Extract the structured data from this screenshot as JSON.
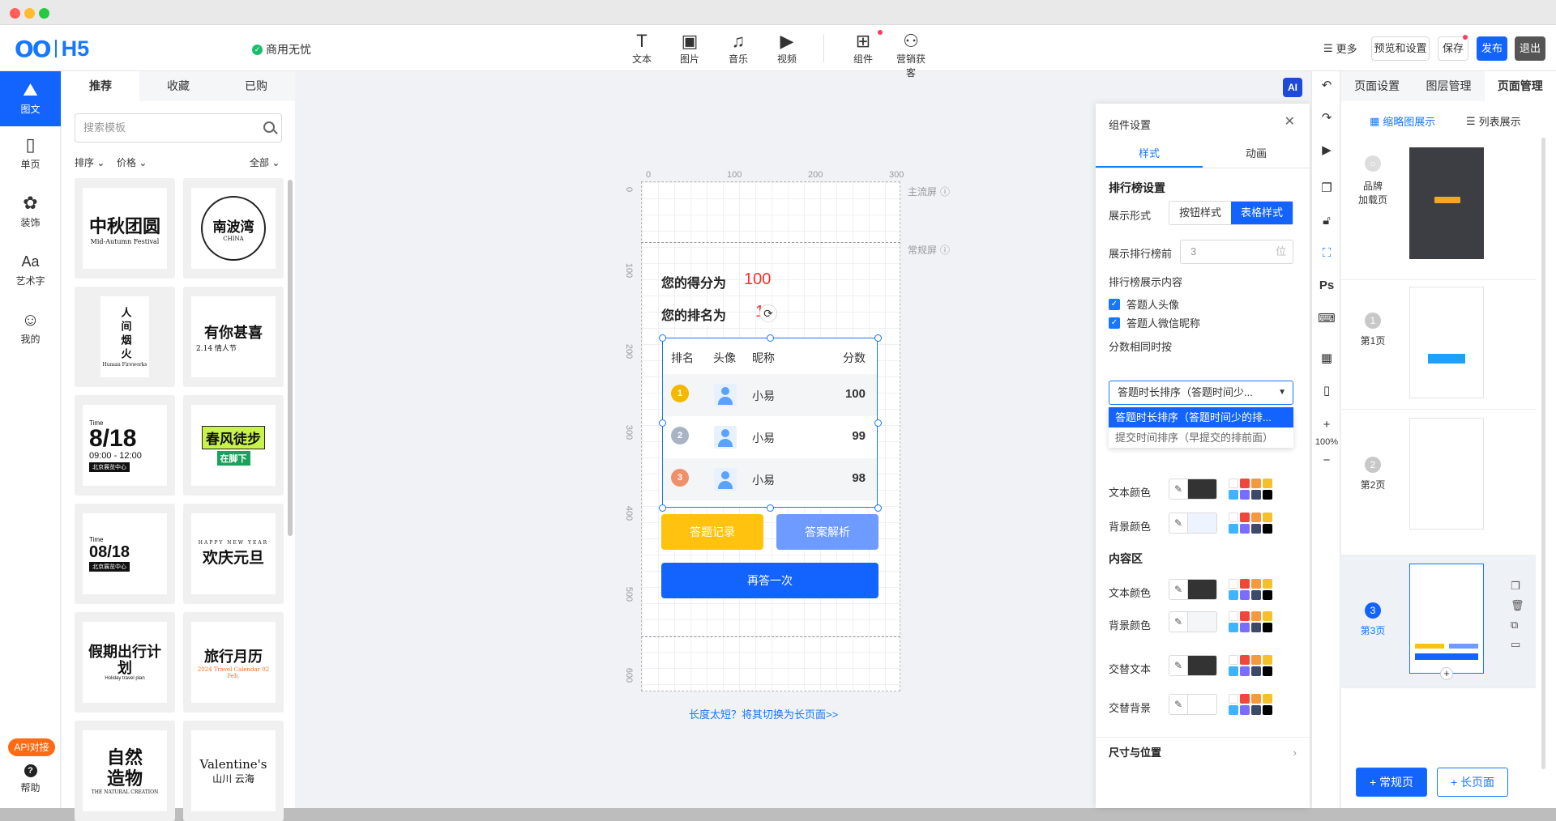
{
  "header": {
    "logo_mark": "OO",
    "logo_text": "H5",
    "status": "商用无忧",
    "tools": [
      {
        "label": "文本",
        "icon": "text-icon",
        "glyph": "T"
      },
      {
        "label": "图片",
        "icon": "image-icon",
        "glyph": "▣"
      },
      {
        "label": "音乐",
        "icon": "music-icon",
        "glyph": "♫"
      },
      {
        "label": "视频",
        "icon": "video-icon",
        "glyph": "▶"
      },
      {
        "label": "组件",
        "icon": "component-icon",
        "glyph": "⊞"
      },
      {
        "label": "营销获客",
        "icon": "users-icon",
        "glyph": "⚇"
      }
    ],
    "more": "更多",
    "preview": "预览和设置",
    "save": "保存",
    "publish": "发布",
    "exit": "退出"
  },
  "left_nav": {
    "items": [
      {
        "label": "图文",
        "icon": "image-text-icon",
        "glyph": "⛰"
      },
      {
        "label": "单页",
        "icon": "single-page-icon",
        "glyph": "▯"
      },
      {
        "label": "装饰",
        "icon": "palette-icon",
        "glyph": "✿"
      },
      {
        "label": "艺术字",
        "icon": "art-text-icon",
        "glyph": "Aa"
      },
      {
        "label": "我的",
        "icon": "user-icon",
        "glyph": "☺"
      }
    ],
    "api": "API对接",
    "help": "帮助",
    "help_glyph": "?"
  },
  "templates": {
    "tabs": [
      "推荐",
      "收藏",
      "已购"
    ],
    "search_placeholder": "搜索模板",
    "filters": {
      "sort": "排序",
      "price": "价格",
      "all": "全部"
    },
    "cards": [
      {
        "text": "中秋团圆",
        "sub": "Mid-Autumn Festival"
      },
      {
        "text": "南波湾",
        "sub": "CHINA"
      },
      {
        "text": "人间烟火",
        "sub": "Human Fireworks"
      },
      {
        "text": "有你甚喜",
        "sub": "2.14 情人节"
      },
      {
        "text": "8/18",
        "sub": "09:00 - 12:00",
        "note": "北京展览中心",
        "top": "Time"
      },
      {
        "text": "春风徒步",
        "sub": "在脚下"
      },
      {
        "text": "08/18",
        "sub": "北京展览中心",
        "top": "Time"
      },
      {
        "text": "欢庆元旦",
        "sub": "HAPPY NEW YEAR"
      },
      {
        "text": "假期出行计划",
        "sub": "Holiday travel plan"
      },
      {
        "text": "旅行月历",
        "sub": "2024 Travel Calendar 02 Feb."
      },
      {
        "text": "自然造物",
        "sub": "THE NATURAL CREATION"
      },
      {
        "text": "Valentine's",
        "sub": "山川 云海"
      }
    ]
  },
  "canvas": {
    "ruler_top": [
      "0",
      "100",
      "200",
      "300"
    ],
    "ruler_left": [
      "0",
      "100",
      "200",
      "300",
      "400",
      "500",
      "600"
    ],
    "main_screen": "主流屏",
    "normal_screen": "常规屏",
    "score_label": "您的得分为",
    "score_value": "100",
    "rank_label": "您的排名为",
    "rank_value": "1",
    "table": {
      "headers": [
        "排名",
        "头像",
        "昵称",
        "分数"
      ],
      "rows": [
        {
          "rank": "1",
          "name": "小易",
          "score": "100",
          "color": "#f5b800"
        },
        {
          "rank": "2",
          "name": "小易",
          "score": "99",
          "color": "#a8b4c4"
        },
        {
          "rank": "3",
          "name": "小易",
          "score": "98",
          "color": "#f0906a"
        }
      ]
    },
    "btn_record": "答题记录",
    "btn_analysis": "答案解析",
    "btn_retry": "再答一次",
    "switch_link": "长度太短？将其切换为长页面>>",
    "ai": "AI"
  },
  "settings": {
    "title": "组件设置",
    "tabs": [
      "样式",
      "动画"
    ],
    "sec_rank": "排行榜设置",
    "display_mode": "展示形式",
    "mode_btn": "按钮样式",
    "mode_table": "表格样式",
    "top_n_label": "展示排行榜前",
    "top_n": "3",
    "top_n_unit": "位",
    "content_label": "排行榜展示内容",
    "chk_avatar": "答题人头像",
    "chk_nick": "答题人微信昵称",
    "tie_label": "分数相同时按",
    "tie_selected": "答题时长排序（答题时间少...",
    "tie_opt1": "答题时长排序（答题时间少的排...",
    "tie_opt2": "提交时间排序（早提交的排前面）",
    "text_color": "文本颜色",
    "bg_color": "背景颜色",
    "sec_content": "内容区",
    "alt_text": "交替文本",
    "alt_bg": "交替背景",
    "size_pos": "尺寸与位置",
    "colors": {
      "accent": "#1364ff",
      "dark_swatch": "#333333",
      "light_swatch": "#eef4ff"
    }
  },
  "rtools": {
    "zoom": "100%",
    "ps": "Ps"
  },
  "pages": {
    "tabs": [
      "页面设置",
      "图层管理",
      "页面管理"
    ],
    "view_thumb": "缩略图展示",
    "view_list": "列表展示",
    "items": [
      {
        "num": "○",
        "label": "品牌加载页",
        "line1": "品牌",
        "line2": "加载页"
      },
      {
        "num": "1",
        "label": "第1页"
      },
      {
        "num": "2",
        "label": "第2页"
      },
      {
        "num": "3",
        "label": "第3页"
      }
    ],
    "add_normal": "+ 常规页",
    "add_long": "+ 长页面"
  }
}
